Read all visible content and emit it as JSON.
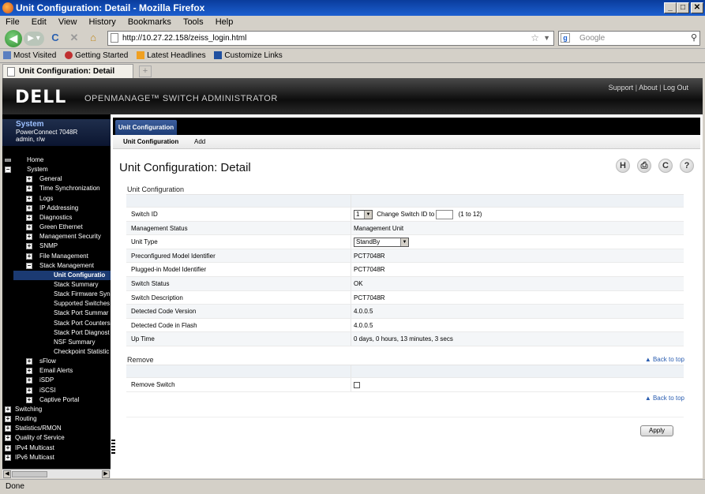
{
  "window": {
    "title": "Unit Configuration: Detail - Mozilla Firefox"
  },
  "menu": [
    "File",
    "Edit",
    "View",
    "History",
    "Bookmarks",
    "Tools",
    "Help"
  ],
  "nav": {
    "url": "http://10.27.22.158/zeiss_login.html",
    "search_placeholder": "Google"
  },
  "bookmarks": [
    "Most Visited",
    "Getting Started",
    "Latest Headlines",
    "Customize Links"
  ],
  "browser_tab": {
    "label": "Unit Configuration: Detail",
    "new_tab": "+"
  },
  "header": {
    "logo": "DELL",
    "product": "OPENMANAGE™ SWITCH ADMINISTRATOR",
    "support": "Support",
    "about": "About",
    "logout": "Log Out",
    "sep": "|"
  },
  "system": {
    "title": "System",
    "model": "PowerConnect 7048R",
    "user": "admin, r/w"
  },
  "tree": [
    {
      "label": "Home"
    },
    {
      "label": "System"
    },
    {
      "label": "General"
    },
    {
      "label": "Time Synchronization"
    },
    {
      "label": "Logs"
    },
    {
      "label": "IP Addressing"
    },
    {
      "label": "Diagnostics"
    },
    {
      "label": "Green Ethernet"
    },
    {
      "label": "Management Security"
    },
    {
      "label": "SNMP"
    },
    {
      "label": "File Management"
    },
    {
      "label": "Stack Management"
    },
    {
      "label": "Unit Configuratio"
    },
    {
      "label": "Stack Summary"
    },
    {
      "label": "Stack Firmware Syn"
    },
    {
      "label": "Supported Switches"
    },
    {
      "label": "Stack Port Summar"
    },
    {
      "label": "Stack Port Counters"
    },
    {
      "label": "Stack Port Diagnost"
    },
    {
      "label": "NSF Summary"
    },
    {
      "label": "Checkpoint Statistic"
    },
    {
      "label": "sFlow"
    },
    {
      "label": "Email Alerts"
    },
    {
      "label": "iSDP"
    },
    {
      "label": "iSCSI"
    },
    {
      "label": "Captive Portal"
    },
    {
      "label": "Switching"
    },
    {
      "label": "Routing"
    },
    {
      "label": "Statistics/RMON"
    },
    {
      "label": "Quality of Service"
    },
    {
      "label": "IPv4 Multicast"
    },
    {
      "label": "IPv6 Multicast"
    }
  ],
  "content": {
    "tab": "Unit Configuration",
    "subnav": [
      "Unit Configuration",
      "Add"
    ],
    "page_title": "Unit Configuration: Detail",
    "icons": [
      "H",
      "⎙",
      "C",
      "?"
    ],
    "section1": "Unit Configuration",
    "rows": [
      {
        "label": "Switch ID",
        "value": "1"
      },
      {
        "label": "Management Status",
        "value": "Management Unit"
      },
      {
        "label": "Unit Type",
        "value": "StandBy"
      },
      {
        "label": "Preconfigured Model Identifier",
        "value": "PCT7048R"
      },
      {
        "label": "Plugged-in Model Identifier",
        "value": "PCT7048R"
      },
      {
        "label": "Switch Status",
        "value": "OK"
      },
      {
        "label": "Switch Description",
        "value": "PCT7048R"
      },
      {
        "label": "Detected Code Version",
        "value": "4.0.0.5"
      },
      {
        "label": "Detected Code in Flash",
        "value": "4.0.0.5"
      },
      {
        "label": "Up Time",
        "value": "0 days, 0 hours, 13 minutes, 3 secs"
      }
    ],
    "change_id_label": "Change Switch ID to",
    "change_id_range": "(1 to 12)",
    "section2": "Remove",
    "remove_label": "Remove Switch",
    "back_to_top": "▲ Back to top",
    "apply": "Apply"
  },
  "status": "Done"
}
